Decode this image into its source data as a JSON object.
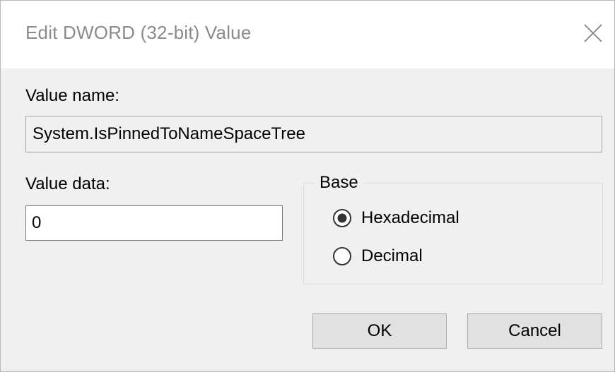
{
  "window": {
    "title": "Edit DWORD (32-bit) Value"
  },
  "value_name": {
    "label": "Value name:",
    "value": "System.IsPinnedToNameSpaceTree"
  },
  "value_data": {
    "label": "Value data:",
    "value": "0"
  },
  "base": {
    "title": "Base",
    "options": [
      {
        "label": "Hexadecimal",
        "selected": true
      },
      {
        "label": "Decimal",
        "selected": false
      }
    ]
  },
  "buttons": {
    "ok_label": "OK",
    "cancel_label": "Cancel"
  },
  "icons": {
    "close": "close-icon",
    "radio_selected": "radio-selected-icon",
    "radio_unselected": "radio-unselected-icon"
  }
}
